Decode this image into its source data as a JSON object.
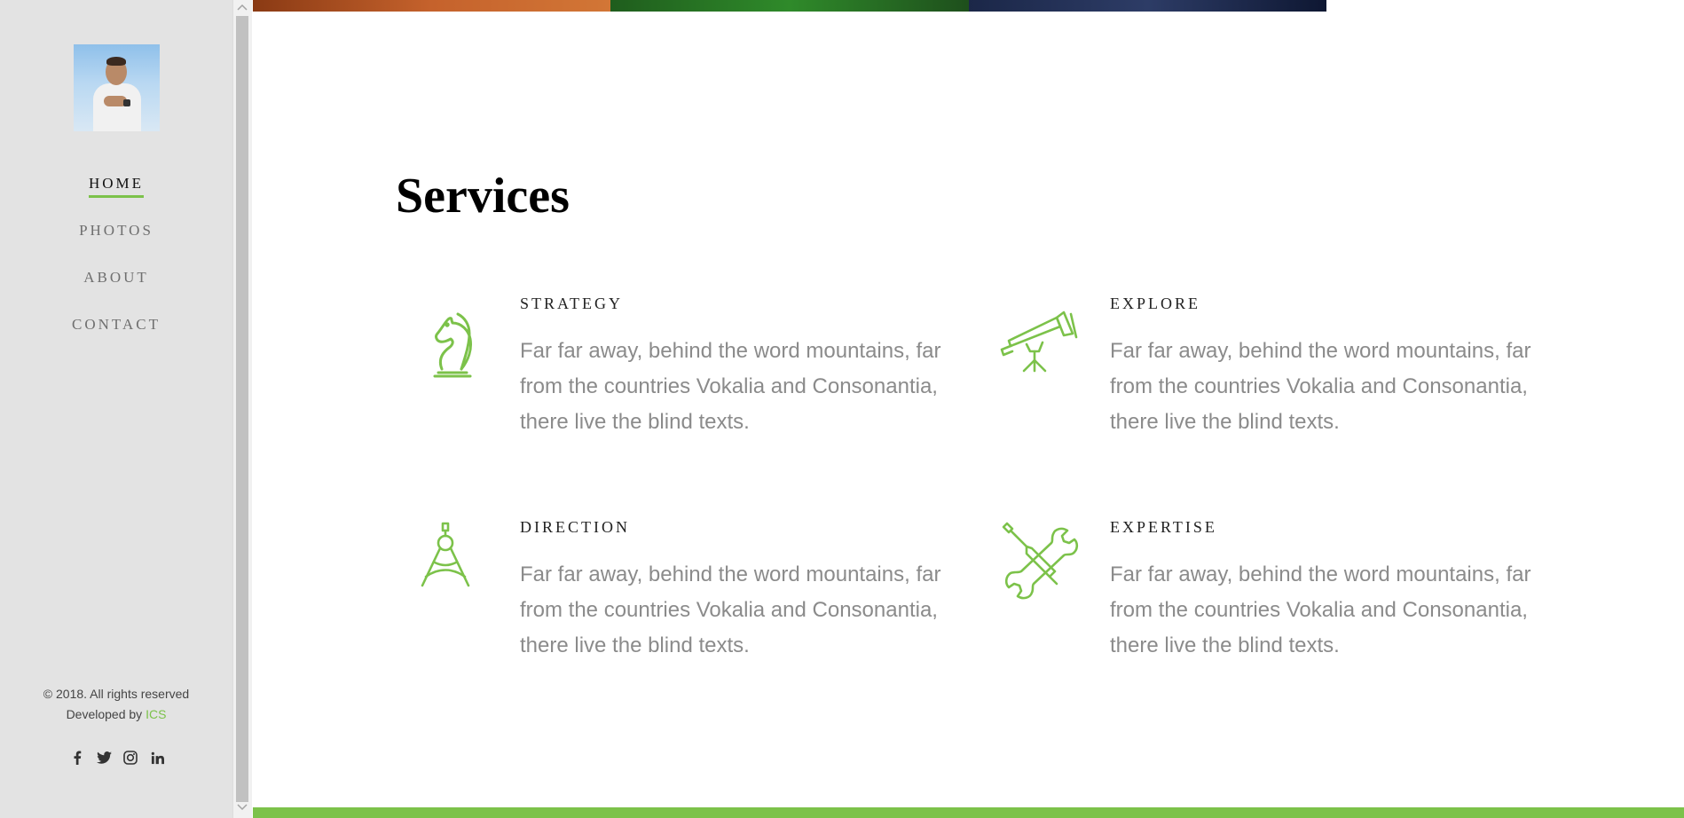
{
  "colors": {
    "accent": "#7cc24a",
    "sidebar_bg": "#e3e3e3",
    "text_muted": "#8b8b8b"
  },
  "sidebar": {
    "nav": [
      {
        "label": "HOME",
        "active": true
      },
      {
        "label": "PHOTOS",
        "active": false
      },
      {
        "label": "ABOUT",
        "active": false
      },
      {
        "label": "CONTACT",
        "active": false
      }
    ],
    "copyright": "© 2018. All rights reserved",
    "developed_by": "Developed by",
    "developer": "ICS",
    "socials": [
      "facebook-icon",
      "twitter-icon",
      "instagram-icon",
      "linkedin-icon"
    ]
  },
  "main": {
    "title": "Services",
    "services": [
      {
        "title": "STRATEGY",
        "icon": "chess-knight-icon",
        "text": "Far far away, behind the word mountains, far from the countries Vokalia and Consonantia, there live the blind texts."
      },
      {
        "title": "EXPLORE",
        "icon": "telescope-icon",
        "text": "Far far away, behind the word mountains, far from the countries Vokalia and Consonantia, there live the blind texts."
      },
      {
        "title": "DIRECTION",
        "icon": "compass-icon",
        "text": "Far far away, behind the word mountains, far from the countries Vokalia and Consonantia, there live the blind texts."
      },
      {
        "title": "EXPERTISE",
        "icon": "tools-icon",
        "text": "Far far away, behind the word mountains, far from the countries Vokalia and Consonantia, there live the blind texts."
      }
    ]
  }
}
